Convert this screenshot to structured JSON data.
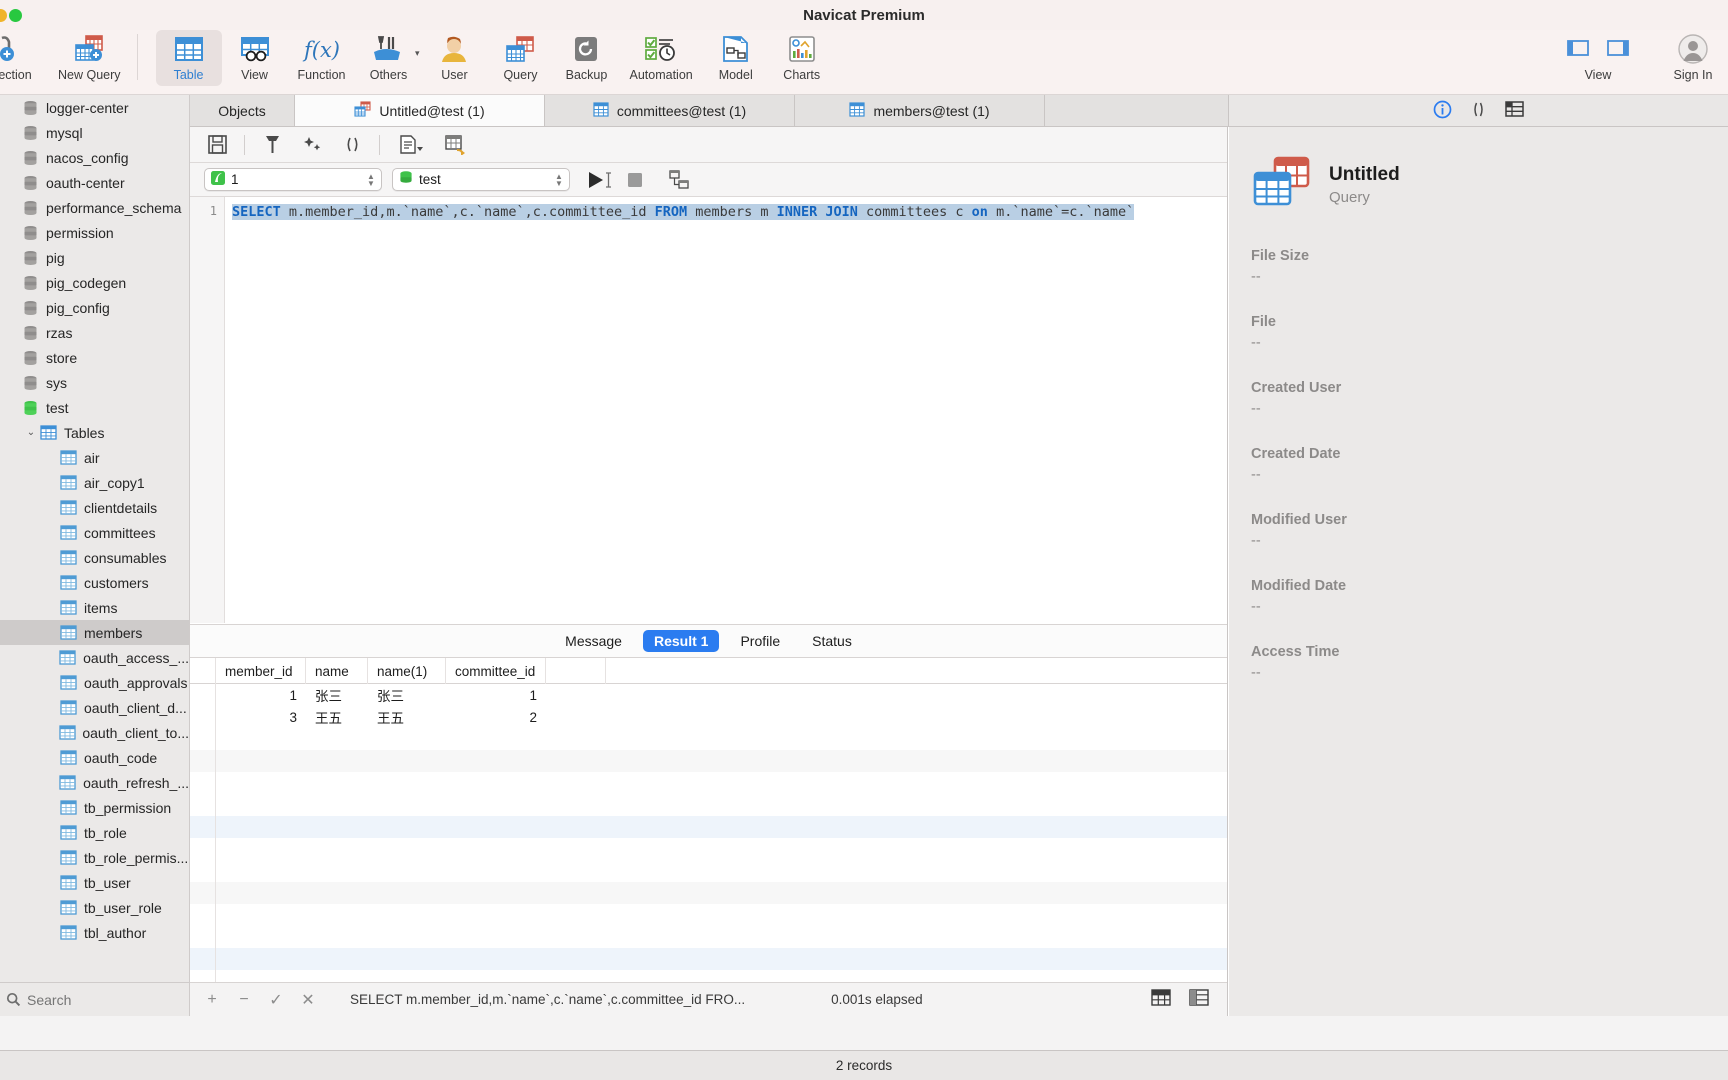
{
  "window": {
    "title": "Navicat Premium"
  },
  "toolbar": {
    "left": [
      {
        "name": "connection",
        "label": "ection",
        "icon": "new-connection-icon"
      },
      {
        "name": "new-query",
        "label": "New Query",
        "icon": "new-query-icon"
      }
    ],
    "main": [
      {
        "name": "table",
        "label": "Table",
        "icon": "table-icon",
        "selected": true
      },
      {
        "name": "view",
        "label": "View",
        "icon": "view-icon",
        "selected": false
      },
      {
        "name": "function",
        "label": "Function",
        "icon": "function-icon",
        "selected": false
      },
      {
        "name": "others",
        "label": "Others",
        "icon": "others-icon",
        "selected": false,
        "caret": true
      },
      {
        "name": "user",
        "label": "User",
        "icon": "user-icon",
        "selected": false
      },
      {
        "name": "query",
        "label": "Query",
        "icon": "query-icon",
        "selected": false
      },
      {
        "name": "backup",
        "label": "Backup",
        "icon": "backup-icon",
        "selected": false
      },
      {
        "name": "automation",
        "label": "Automation",
        "icon": "automation-icon",
        "selected": false
      },
      {
        "name": "model",
        "label": "Model",
        "icon": "model-icon",
        "selected": false
      },
      {
        "name": "charts",
        "label": "Charts",
        "icon": "charts-icon",
        "selected": false
      }
    ],
    "right": {
      "view_label": "View",
      "sign_in_label": "Sign In",
      "left_pane_icon": "left-panel-toggle-icon",
      "right_pane_icon": "right-panel-toggle-icon",
      "avatar_icon": "user-avatar-icon"
    }
  },
  "sidebar": {
    "search_placeholder": "Search",
    "search_value": "",
    "items": [
      {
        "label": "logger-center",
        "type": "database",
        "indent": 1,
        "selected": false
      },
      {
        "label": "mysql",
        "type": "database",
        "indent": 1,
        "selected": false
      },
      {
        "label": "nacos_config",
        "type": "database",
        "indent": 1,
        "selected": false
      },
      {
        "label": "oauth-center",
        "type": "database",
        "indent": 1,
        "selected": false
      },
      {
        "label": "performance_schema",
        "type": "database",
        "indent": 1,
        "selected": false
      },
      {
        "label": "permission",
        "type": "database",
        "indent": 1,
        "selected": false
      },
      {
        "label": "pig",
        "type": "database",
        "indent": 1,
        "selected": false
      },
      {
        "label": "pig_codegen",
        "type": "database",
        "indent": 1,
        "selected": false
      },
      {
        "label": "pig_config",
        "type": "database",
        "indent": 1,
        "selected": false
      },
      {
        "label": "rzas",
        "type": "database",
        "indent": 1,
        "selected": false
      },
      {
        "label": "store",
        "type": "database",
        "indent": 1,
        "selected": false
      },
      {
        "label": "sys",
        "type": "database",
        "indent": 1,
        "selected": false
      },
      {
        "label": "test",
        "type": "database-open",
        "indent": 1,
        "selected": false
      },
      {
        "label": "Tables",
        "type": "folder",
        "indent": 2,
        "selected": false,
        "expanded": true
      },
      {
        "label": "air",
        "type": "table",
        "indent": 3,
        "selected": false
      },
      {
        "label": "air_copy1",
        "type": "table",
        "indent": 3,
        "selected": false
      },
      {
        "label": "clientdetails",
        "type": "table",
        "indent": 3,
        "selected": false
      },
      {
        "label": "committees",
        "type": "table",
        "indent": 3,
        "selected": false
      },
      {
        "label": "consumables",
        "type": "table",
        "indent": 3,
        "selected": false
      },
      {
        "label": "customers",
        "type": "table",
        "indent": 3,
        "selected": false
      },
      {
        "label": "items",
        "type": "table",
        "indent": 3,
        "selected": false
      },
      {
        "label": "members",
        "type": "table",
        "indent": 3,
        "selected": true
      },
      {
        "label": "oauth_access_...",
        "type": "table",
        "indent": 3,
        "selected": false
      },
      {
        "label": "oauth_approvals",
        "type": "table",
        "indent": 3,
        "selected": false
      },
      {
        "label": "oauth_client_d...",
        "type": "table",
        "indent": 3,
        "selected": false
      },
      {
        "label": "oauth_client_to...",
        "type": "table",
        "indent": 3,
        "selected": false
      },
      {
        "label": "oauth_code",
        "type": "table",
        "indent": 3,
        "selected": false
      },
      {
        "label": "oauth_refresh_...",
        "type": "table",
        "indent": 3,
        "selected": false
      },
      {
        "label": "tb_permission",
        "type": "table",
        "indent": 3,
        "selected": false
      },
      {
        "label": "tb_role",
        "type": "table",
        "indent": 3,
        "selected": false
      },
      {
        "label": "tb_role_permis...",
        "type": "table",
        "indent": 3,
        "selected": false
      },
      {
        "label": "tb_user",
        "type": "table",
        "indent": 3,
        "selected": false
      },
      {
        "label": "tb_user_role",
        "type": "table",
        "indent": 3,
        "selected": false
      },
      {
        "label": "tbl_author",
        "type": "table",
        "indent": 3,
        "selected": false
      }
    ]
  },
  "tabs": [
    {
      "label": "Objects",
      "icon": null,
      "active": false
    },
    {
      "label": "Untitled@test (1)",
      "icon": "query-tab-icon",
      "active": true
    },
    {
      "label": "committees@test (1)",
      "icon": "table-tab-icon",
      "active": false
    },
    {
      "label": "members@test (1)",
      "icon": "table-tab-icon",
      "active": false
    }
  ],
  "editor": {
    "toolbar_icons": [
      "save-icon",
      "beautify-icon",
      "code-complete-icon",
      "parentheses-icon",
      "explain-icon",
      "query-builder-icon"
    ],
    "limit_value": "1",
    "database_value": "test",
    "run_icon": "run-icon",
    "stop_icon": "stop-icon",
    "builder_icon": "query-builder-small-icon",
    "line_number": "1",
    "sql": {
      "full": "SELECT m.member_id,m.`name`,c.`name`,c.committee_id FROM members m INNER JOIN committees c on m.`name`=c.`name`",
      "tokens": [
        {
          "t": "SELECT",
          "k": true
        },
        {
          "t": " m.member_id,m.`name`,c.`name`,c.committee_id ",
          "k": false
        },
        {
          "t": "FROM",
          "k": true
        },
        {
          "t": " members m ",
          "k": false
        },
        {
          "t": "INNER",
          "k": true
        },
        {
          "t": " ",
          "k": false
        },
        {
          "t": "JOIN",
          "k": true
        },
        {
          "t": " committees c ",
          "k": false
        },
        {
          "t": "on",
          "k": true
        },
        {
          "t": " m.`name`=c.`name`",
          "k": false
        }
      ]
    }
  },
  "result_tabs": [
    {
      "label": "Message",
      "active": false
    },
    {
      "label": "Result 1",
      "active": true
    },
    {
      "label": "Profile",
      "active": false
    },
    {
      "label": "Status",
      "active": false
    }
  ],
  "grid": {
    "columns": [
      "member_id",
      "name",
      "name(1)",
      "committee_id"
    ],
    "rows": [
      [
        "1",
        "张三",
        "张三",
        "1"
      ],
      [
        "3",
        "王五",
        "王五",
        "2"
      ]
    ]
  },
  "editor_status": {
    "add_icon": "add-record-icon",
    "remove_icon": "remove-record-icon",
    "apply_icon": "apply-change-icon",
    "cancel_icon": "cancel-change-icon",
    "sql_text": "SELECT m.member_id,m.`name`,c.`name`,c.committee_id FRO...",
    "elapsed": "0.001s elapsed",
    "grid_view_icon": "grid-view-icon",
    "form_view_icon": "form-view-icon"
  },
  "info_panel": {
    "icon": "query-file-icon",
    "title": "Untitled",
    "subtitle": "Query",
    "fields": [
      {
        "key": "File Size",
        "value": "--"
      },
      {
        "key": "File",
        "value": "--"
      },
      {
        "key": "Created User",
        "value": "--"
      },
      {
        "key": "Created Date",
        "value": "--"
      },
      {
        "key": "Modified User",
        "value": "--"
      },
      {
        "key": "Modified Date",
        "value": "--"
      },
      {
        "key": "Access Time",
        "value": "--"
      }
    ],
    "header_icons": [
      "info-icon",
      "parentheses-icon",
      "table-structure-icon"
    ]
  },
  "footer": {
    "records": "2 records"
  },
  "colors": {
    "accent": "#2b7cf0",
    "selection": "#b9cfe4",
    "keyword": "#1565c0"
  }
}
